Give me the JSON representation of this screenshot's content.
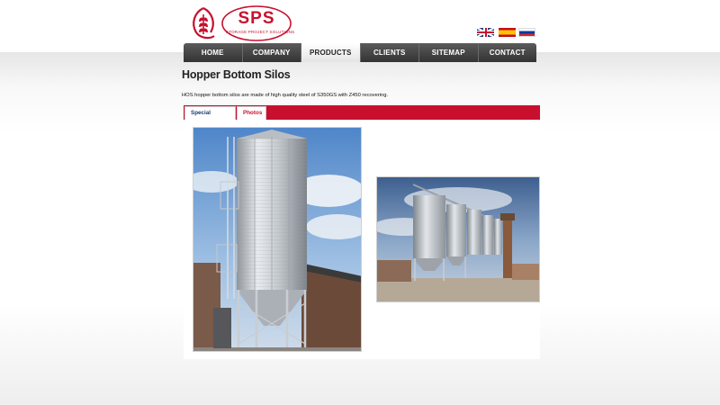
{
  "header": {
    "logo": {
      "text": "SPS",
      "subtitle": "STORAGE PROJECT SOLUTIONS",
      "brand_color": "#c8102e"
    },
    "languages": [
      {
        "icon": "uk-flag-icon"
      },
      {
        "icon": "spain-flag-icon"
      },
      {
        "icon": "russia-flag-icon"
      }
    ]
  },
  "nav": {
    "items": [
      {
        "label": "HOME"
      },
      {
        "label": "COMPANY"
      },
      {
        "label": "PRODUCTS"
      },
      {
        "label": "CLIENTS"
      },
      {
        "label": "SITEMAP"
      },
      {
        "label": "CONTACT"
      }
    ],
    "active_index": 2
  },
  "main": {
    "title": "Hopper Bottom Silos",
    "description": "HOS hopper bottom silos are made of high quality steel of S350GS with Z450 recovering.",
    "tabs": [
      {
        "label": "Special features"
      },
      {
        "label": "Photos"
      }
    ],
    "active_tab": 1,
    "photos": [
      {
        "subject": "single-tall-hopper-silo-photo"
      },
      {
        "subject": "row-of-silos-photo"
      }
    ],
    "accent_color": "#c8102e"
  }
}
